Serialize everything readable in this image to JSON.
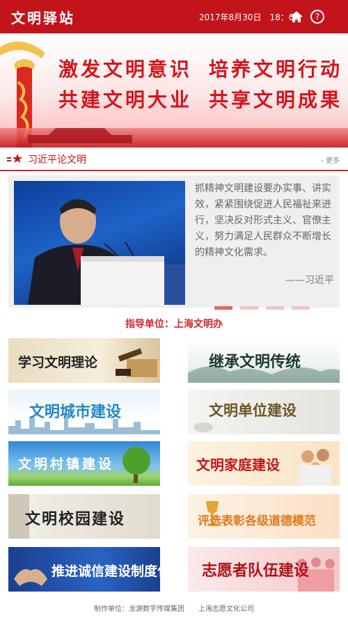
{
  "header": {
    "title": "文明驿站",
    "datetime": "2017年8月30日　18：00"
  },
  "banner": {
    "slogan_left_1": "激发文明意识",
    "slogan_right_1": "培养文明行动",
    "slogan_left_2": "共建文明大业",
    "slogan_right_2": "共享文明成果"
  },
  "section": {
    "title": "习近平论文明",
    "more": "更多"
  },
  "quote": {
    "text": "抓精神文明建设要办实事、讲实效，紧紧围绕促进人民福祉来进行，坚决反对形式主义、官僚主义，努力满足人民群众不断增长的精神文化需求。",
    "author": "——习近平",
    "carousel_active_index": 0,
    "carousel_count": 4
  },
  "guide": "指导单位：上海文明办",
  "tiles": [
    {
      "label": "学习文明理论"
    },
    {
      "label": "继承文明传统"
    },
    {
      "label": "文明城市建设"
    },
    {
      "label": "文明单位建设"
    },
    {
      "label": "文明村镇建设"
    },
    {
      "label": "文明家庭建设"
    },
    {
      "label": "文明校园建设"
    },
    {
      "label": "评选表彰各级道德模范"
    },
    {
      "label": "推进诚信建设制度化"
    },
    {
      "label": "志愿者队伍建设"
    }
  ],
  "footer": "制作单位：龙源数字传媒集团　　上海志愿文化公司",
  "colors": {
    "brand_red": "#c4141b",
    "accent_red": "#d2262a"
  }
}
